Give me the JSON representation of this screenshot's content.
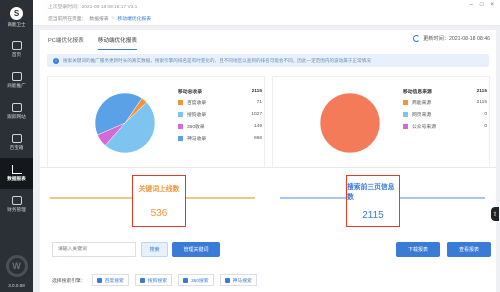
{
  "app": {
    "logo_text": "商能卫士",
    "version": "3.0.0.68",
    "circle_letter": "W",
    "titlebar_text": "上次登录时间：2021-08-18 09:18:17 V3.1"
  },
  "window_controls": [
    "–",
    "□",
    "×"
  ],
  "sidebar": {
    "items": [
      {
        "label": "首页"
      },
      {
        "label": "商能推广"
      },
      {
        "label": "跟踪网站"
      },
      {
        "label": "百宝箱"
      },
      {
        "label": "数据报表"
      },
      {
        "label": "财务管理"
      }
    ],
    "active_index": 4
  },
  "breadcrumb": [
    "您当前所在页面：",
    "数据报表",
    ">",
    "移动端优化报表"
  ],
  "tabs": [
    "PC端优化报表",
    "移动端优化报表"
  ],
  "active_tab": 1,
  "update_time": "更新时间：2021-08-18 08:46",
  "notice": "搜索关键词的推广服务更新时长的真实数据，搜索引擎的排名是有时变化的，且不同地区以查到的排名可能会不同，因此一定范围内的波动属于正常情况",
  "left_card": {
    "header_label": "移动总收录",
    "header_value": "2115",
    "rows": [
      {
        "name": "百度收录",
        "value": "71",
        "color": "#f2943a"
      },
      {
        "name": "搜狗收录",
        "value": "1027",
        "color": "#7ec4f0"
      },
      {
        "name": "360收录",
        "value": "149",
        "color": "#d46ad9"
      },
      {
        "name": "神马收录",
        "value": "868",
        "color": "#5aa1e8"
      }
    ]
  },
  "right_card": {
    "header_label": "移动信息来源",
    "header_value": "2115",
    "rows": [
      {
        "name": "商能来源",
        "value": "2115",
        "color": "#f2943a"
      },
      {
        "name": "网页来源",
        "value": "0",
        "color": "#7ec4f0"
      },
      {
        "name": "公众号来源",
        "value": "0",
        "color": "#d46ad9"
      }
    ]
  },
  "chart_data": [
    {
      "type": "pie",
      "title": "",
      "categories": [
        "百度收录",
        "搜狗收录",
        "360收录",
        "神马收录"
      ],
      "values": [
        71,
        1027,
        149,
        868
      ],
      "colors": [
        "#f2943a",
        "#7ec4f0",
        "#d46ad9",
        "#5aa1e8"
      ]
    },
    {
      "type": "pie",
      "title": "",
      "categories": [
        "商能来源",
        "网页来源",
        "公众号来源"
      ],
      "values": [
        2115,
        0,
        0
      ],
      "colors": [
        "#f47b5a",
        "#7ec4f0",
        "#d46ad9"
      ]
    }
  ],
  "stats": {
    "keywords_label": "关键词上线数",
    "keywords_value": "536",
    "keywords_color": "#f2943a",
    "top3_label": "搜索前三页信息数",
    "top3_value": "2115",
    "top3_color": "#3a7bd5"
  },
  "controls": {
    "keyword_placeholder": "请输入关键词",
    "search_label": "搜索",
    "manage_label": "管理关键词",
    "download_label": "下载报表",
    "query_label": "查看报表",
    "engine_title": "选择搜索引擎：",
    "engines": [
      "百度搜索",
      "搜狗搜索",
      "360搜索",
      "神马搜索"
    ]
  }
}
